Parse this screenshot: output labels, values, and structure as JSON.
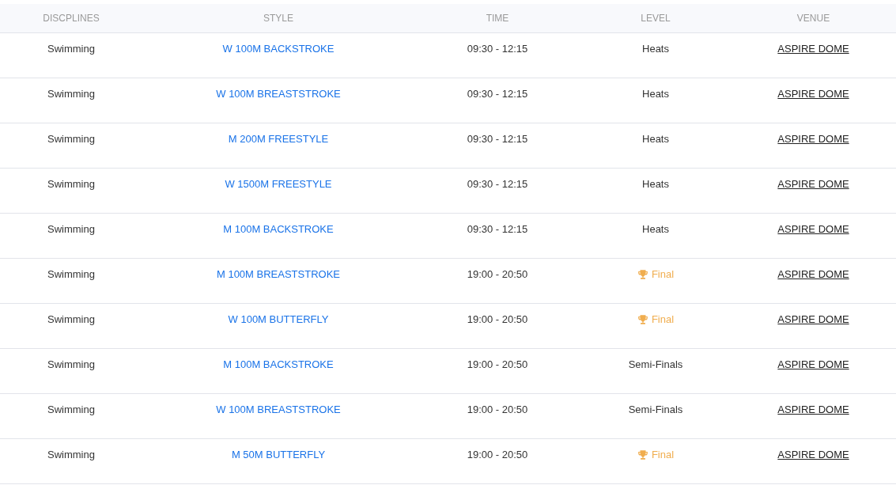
{
  "table": {
    "columns": [
      "DISCPLINES",
      "STYLE",
      "TIME",
      "LEVEL",
      "VENUE"
    ],
    "rows": [
      {
        "discipline": "Swimming",
        "style": "W 100M BACKSTROKE",
        "time": "09:30 - 12:15",
        "level": {
          "kind": "plain",
          "text": "Heats"
        },
        "venue": "ASPIRE DOME"
      },
      {
        "discipline": "Swimming",
        "style": "W 100M BREASTSTROKE",
        "time": "09:30 - 12:15",
        "level": {
          "kind": "plain",
          "text": "Heats"
        },
        "venue": "ASPIRE DOME"
      },
      {
        "discipline": "Swimming",
        "style": "M 200M FREESTYLE",
        "time": "09:30 - 12:15",
        "level": {
          "kind": "plain",
          "text": "Heats"
        },
        "venue": "ASPIRE DOME"
      },
      {
        "discipline": "Swimming",
        "style": "W 1500M FREESTYLE",
        "time": "09:30 - 12:15",
        "level": {
          "kind": "plain",
          "text": "Heats"
        },
        "venue": "ASPIRE DOME"
      },
      {
        "discipline": "Swimming",
        "style": "M 100M BACKSTROKE",
        "time": "09:30 - 12:15",
        "level": {
          "kind": "plain",
          "text": "Heats"
        },
        "venue": "ASPIRE DOME"
      },
      {
        "discipline": "Swimming",
        "style": "M 100M BREASTSTROKE",
        "time": "19:00 - 20:50",
        "level": {
          "kind": "final",
          "text": "Final"
        },
        "venue": "ASPIRE DOME"
      },
      {
        "discipline": "Swimming",
        "style": "W 100M BUTTERFLY",
        "time": "19:00 - 20:50",
        "level": {
          "kind": "final",
          "text": "Final"
        },
        "venue": "ASPIRE DOME"
      },
      {
        "discipline": "Swimming",
        "style": "M 100M BACKSTROKE",
        "time": "19:00 - 20:50",
        "level": {
          "kind": "plain",
          "text": "Semi-Finals"
        },
        "venue": "ASPIRE DOME"
      },
      {
        "discipline": "Swimming",
        "style": "W 100M BREASTSTROKE",
        "time": "19:00 - 20:50",
        "level": {
          "kind": "plain",
          "text": "Semi-Finals"
        },
        "venue": "ASPIRE DOME"
      },
      {
        "discipline": "Swimming",
        "style": "M 50M BUTTERFLY",
        "time": "19:00 - 20:50",
        "level": {
          "kind": "final",
          "text": "Final"
        },
        "venue": "ASPIRE DOME"
      }
    ]
  }
}
